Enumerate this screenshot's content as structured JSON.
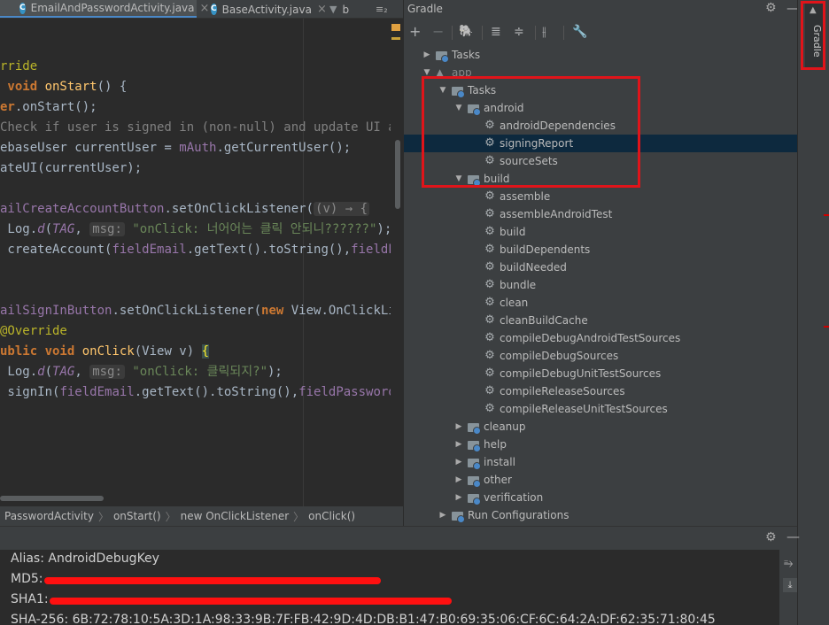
{
  "editor": {
    "tabs": [
      {
        "label": "EmailAndPasswordActivity.java",
        "icon": "C",
        "active": true
      },
      {
        "label": "BaseActivity.java",
        "icon": "C",
        "active": false
      },
      {
        "label": "b",
        "icon": "elephant",
        "active": false
      }
    ],
    "tab_overflow": "≡₂",
    "code_lines": [
      "rride",
      "void onStart() {",
      "er.onStart();",
      "Check if user is signed in (non-null) and update UI accordingly.",
      "ebaseUser currentUser = mAuth.getCurrentUser();",
      "ateUI(currentUser);",
      "ailCreateAccountButton.setOnClickListener((v) → {",
      "Log.d(TAG, msg: \"onClick: 너어어는 클릭 안되니??????\");",
      "createAccount(fieldEmail.getText().toString(),fieldPassword.g",
      "ailSignInButton.setOnClickListener(new View.OnClickListener()",
      "Override",
      "ublic void onClick(View v) {",
      "Log.d(TAG, msg: \"onClick: 클릭되지?\");",
      "signIn(fieldEmail.getText().toString(),fieldPassword.getText()"
    ],
    "breadcrumbs": [
      "PasswordActivity",
      "onStart()",
      "new OnClickListener",
      "onClick()"
    ]
  },
  "gradle": {
    "title": "Gradle",
    "toolbar": [
      "add-icon",
      "remove-icon",
      "elephant-icon",
      "expand-all-icon",
      "collapse-all-icon",
      "toggle-offline-icon",
      "wrench-icon"
    ],
    "tree": [
      {
        "label": "Tasks",
        "level": 0,
        "kind": "folder",
        "arrow": "right"
      },
      {
        "label": "app",
        "level": 0,
        "kind": "elephant",
        "arrow": "down"
      },
      {
        "label": "Tasks",
        "level": 1,
        "kind": "folder",
        "arrow": "down"
      },
      {
        "label": "android",
        "level": 2,
        "kind": "folder",
        "arrow": "down"
      },
      {
        "label": "androidDependencies",
        "level": 3,
        "kind": "task"
      },
      {
        "label": "signingReport",
        "level": 3,
        "kind": "task",
        "selected": true
      },
      {
        "label": "sourceSets",
        "level": 3,
        "kind": "task"
      },
      {
        "label": "build",
        "level": 2,
        "kind": "folder",
        "arrow": "down"
      },
      {
        "label": "assemble",
        "level": 3,
        "kind": "task"
      },
      {
        "label": "assembleAndroidTest",
        "level": 3,
        "kind": "task"
      },
      {
        "label": "build",
        "level": 3,
        "kind": "task"
      },
      {
        "label": "buildDependents",
        "level": 3,
        "kind": "task"
      },
      {
        "label": "buildNeeded",
        "level": 3,
        "kind": "task"
      },
      {
        "label": "bundle",
        "level": 3,
        "kind": "task"
      },
      {
        "label": "clean",
        "level": 3,
        "kind": "task"
      },
      {
        "label": "cleanBuildCache",
        "level": 3,
        "kind": "task"
      },
      {
        "label": "compileDebugAndroidTestSources",
        "level": 3,
        "kind": "task"
      },
      {
        "label": "compileDebugSources",
        "level": 3,
        "kind": "task"
      },
      {
        "label": "compileDebugUnitTestSources",
        "level": 3,
        "kind": "task"
      },
      {
        "label": "compileReleaseSources",
        "level": 3,
        "kind": "task"
      },
      {
        "label": "compileReleaseUnitTestSources",
        "level": 3,
        "kind": "task"
      },
      {
        "label": "cleanup",
        "level": 2,
        "kind": "folder",
        "arrow": "right"
      },
      {
        "label": "help",
        "level": 2,
        "kind": "folder",
        "arrow": "right"
      },
      {
        "label": "install",
        "level": 2,
        "kind": "folder",
        "arrow": "right"
      },
      {
        "label": "other",
        "level": 2,
        "kind": "folder",
        "arrow": "right"
      },
      {
        "label": "verification",
        "level": 2,
        "kind": "folder",
        "arrow": "right"
      },
      {
        "label": "Run Configurations",
        "level": 1,
        "kind": "folder",
        "arrow": "right"
      }
    ]
  },
  "side_tab": {
    "label": "Gradle"
  },
  "output": {
    "lines": [
      {
        "label": "Alias: AndroidDebugKey"
      },
      {
        "label": "MD5:",
        "redacted": true
      },
      {
        "label": "SHA1:",
        "redacted": true
      },
      {
        "label": "SHA-256: 6B:72:78:10:5A:3D:1A:98:33:9B:7F:FB:42:9D:4D:DB:B1:47:B0:69:35:06:CF:6C:64:2A:DF:62:35:71:80:45"
      }
    ]
  },
  "colors": {
    "highlight_box": "#e0141a",
    "selection": "#0d293e",
    "background": "#2b2b2b",
    "panel": "#3c3f41"
  }
}
